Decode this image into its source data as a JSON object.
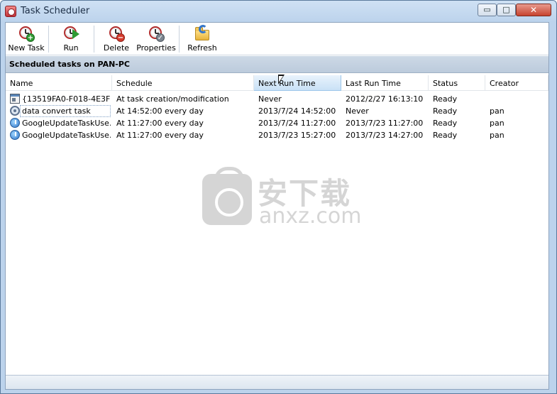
{
  "window": {
    "title": "Task Scheduler",
    "controls": {
      "minimize": "▭",
      "maximize": "□",
      "close": "✕"
    }
  },
  "toolbar": {
    "buttons": [
      {
        "label": "New Task",
        "icon": "new-task-icon"
      },
      {
        "label": "Run",
        "icon": "run-icon"
      },
      {
        "label": "Delete",
        "icon": "delete-icon"
      },
      {
        "label": "Properties",
        "icon": "properties-icon"
      },
      {
        "label": "Refresh",
        "icon": "refresh-icon"
      }
    ]
  },
  "section": {
    "title": "Scheduled tasks on PAN-PC"
  },
  "table": {
    "columns": [
      "Name",
      "Schedule",
      "Next Run Time",
      "Last Run Time",
      "Status",
      "Creator"
    ],
    "rows": [
      {
        "icon": "window-task-icon",
        "name": "{13519FA0-F018-4E3F…",
        "schedule": "At task creation/modification",
        "next_run": "Never",
        "last_run": "2012/2/27 16:13:10",
        "status": "Ready",
        "creator": ""
      },
      {
        "icon": "gear-task-icon",
        "name": "data convert task",
        "schedule": "At 14:52:00 every day",
        "next_run": "2013/7/24 14:52:00",
        "last_run": "Never",
        "status": "Ready",
        "creator": "pan"
      },
      {
        "icon": "update-task-icon",
        "name": "GoogleUpdateTaskUse…",
        "schedule": "At 11:27:00 every day",
        "next_run": "2013/7/24 11:27:00",
        "last_run": "2013/7/23 11:27:00",
        "status": "Ready",
        "creator": "pan"
      },
      {
        "icon": "update-task-icon",
        "name": "GoogleUpdateTaskUse…",
        "schedule": "At 11:27:00 every day",
        "next_run": "2013/7/23 15:27:00",
        "last_run": "2013/7/23 14:27:00",
        "status": "Ready",
        "creator": "pan"
      }
    ]
  },
  "watermark": {
    "text_cn": "安下载",
    "text_en": "anxz.com"
  }
}
